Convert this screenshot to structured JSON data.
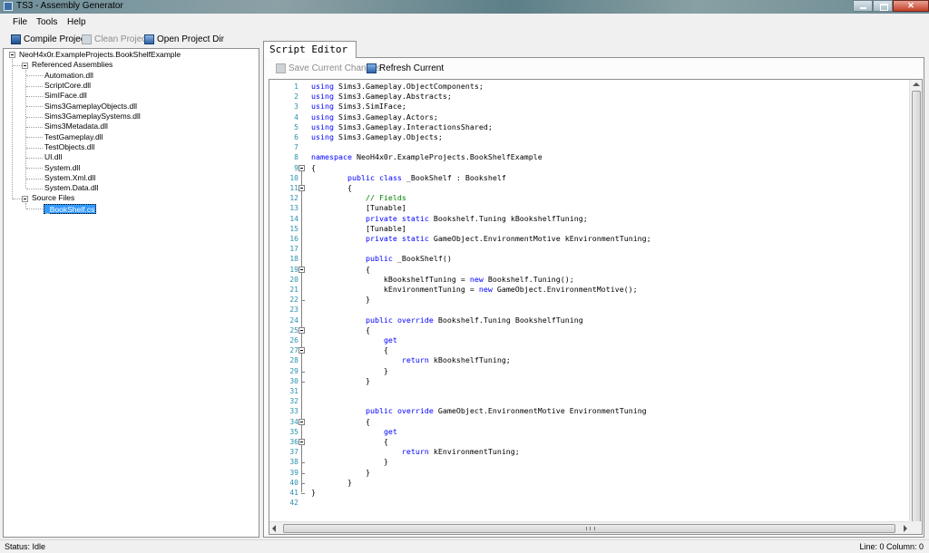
{
  "window": {
    "title": "TS3 - Assembly Generator"
  },
  "menu": [
    "File",
    "Tools",
    "Help"
  ],
  "toolbar": {
    "compile": "Compile Project",
    "clean": "Clean Project",
    "open_dir": "Open Project Dir"
  },
  "tree": {
    "root": "NeoH4x0r.ExampleProjects.BookShelfExample",
    "referenced_label": "Referenced Assemblies",
    "assemblies": [
      "Automation.dll",
      "ScriptCore.dll",
      "SimIFace.dll",
      "Sims3GameplayObjects.dll",
      "Sims3GameplaySystems.dll",
      "Sims3Metadata.dll",
      "TestGameplay.dll",
      "TestObjects.dll",
      "UI.dll",
      "System.dll",
      "System.Xml.dll",
      "System.Data.dll"
    ],
    "sources_label": "Source Files",
    "source_files": [
      "_BookShelf.cs"
    ]
  },
  "editor": {
    "tab_label": "Script Editor",
    "save_label": "Save Current Changes",
    "refresh_label": "Refresh Current",
    "lines": [
      "using Sims3.Gameplay.ObjectComponents;",
      "using Sims3.Gameplay.Abstracts;",
      "using Sims3.SimIFace;",
      "using Sims3.Gameplay.Actors;",
      "using Sims3.Gameplay.InteractionsShared;",
      "using Sims3.Gameplay.Objects;",
      "",
      "namespace NeoH4x0r.ExampleProjects.BookShelfExample",
      "{",
      "        public class _BookShelf : Bookshelf",
      "        {",
      "            // Fields",
      "            [Tunable]",
      "            private static Bookshelf.Tuning kBookshelfTuning;",
      "            [Tunable]",
      "            private static GameObject.EnvironmentMotive kEnvironmentTuning;",
      "",
      "            public _BookShelf()",
      "            {",
      "                kBookshelfTuning = new Bookshelf.Tuning();",
      "                kEnvironmentTuning = new GameObject.EnvironmentMotive();",
      "            }",
      "",
      "            public override Bookshelf.Tuning BookshelfTuning",
      "            {",
      "                get",
      "                {",
      "                    return kBookshelfTuning;",
      "                }",
      "            }",
      "",
      "",
      "            public override GameObject.EnvironmentMotive EnvironmentTuning",
      "            {",
      "                get",
      "                {",
      "                    return kEnvironmentTuning;",
      "                }",
      "            }",
      "        }",
      "}",
      ""
    ]
  },
  "status": {
    "left": "Status:  Idle",
    "right": "Line: 0 Column: 0"
  }
}
